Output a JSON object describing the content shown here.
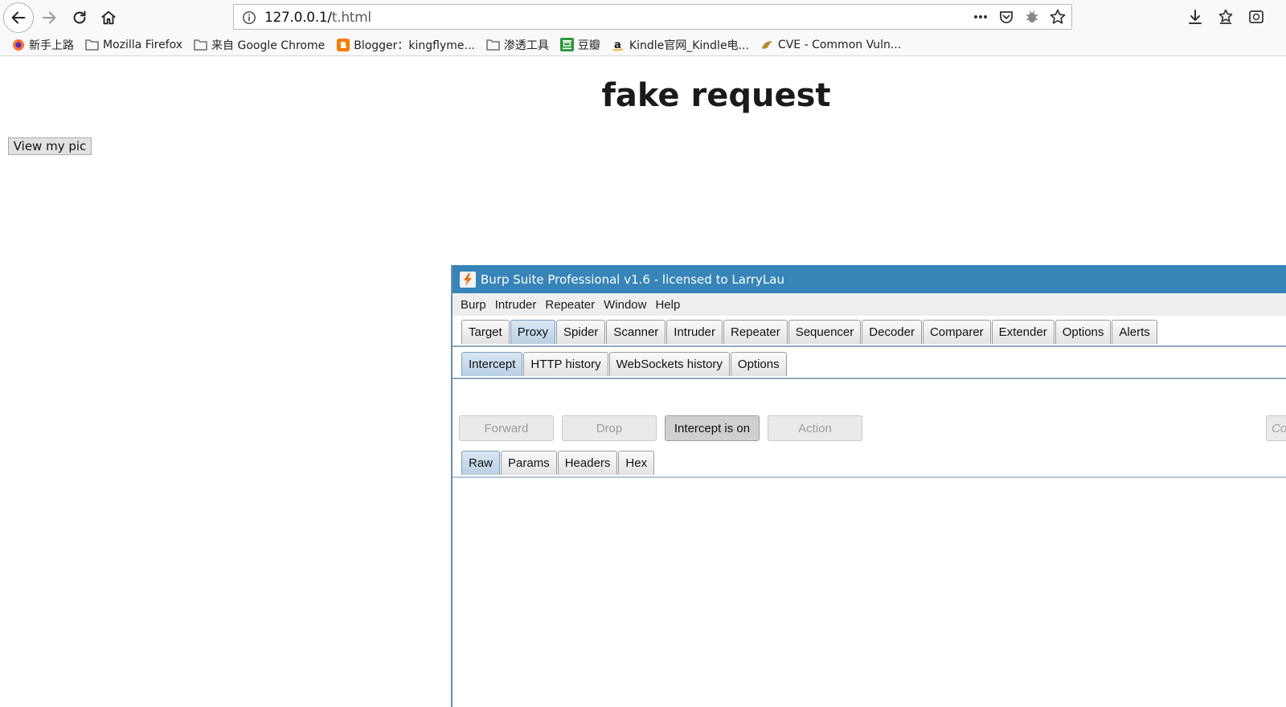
{
  "browser": {
    "url_prefix": "127.0.0.1/",
    "url_path": "t.html",
    "bookmarks": [
      {
        "icon": "firefox-icon",
        "label": "新手上路"
      },
      {
        "icon": "folder-icon",
        "label": "Mozilla Firefox"
      },
      {
        "icon": "folder-icon",
        "label": "来自 Google Chrome"
      },
      {
        "icon": "blogger-icon",
        "label": "Blogger：kingflyme..."
      },
      {
        "icon": "folder-icon",
        "label": "渗透工具"
      },
      {
        "icon": "douban-icon",
        "label": "豆瓣"
      },
      {
        "icon": "amazon-icon",
        "label": "Kindle官网_Kindle电..."
      },
      {
        "icon": "cve-icon",
        "label": "CVE - Common Vuln..."
      }
    ]
  },
  "page": {
    "title": "fake request",
    "button_label": "View my pic"
  },
  "burp": {
    "window_title": "Burp Suite Professional v1.6 - licensed to LarryLau",
    "menu": [
      "Burp",
      "Intruder",
      "Repeater",
      "Window",
      "Help"
    ],
    "main_tabs": [
      "Target",
      "Proxy",
      "Spider",
      "Scanner",
      "Intruder",
      "Repeater",
      "Sequencer",
      "Decoder",
      "Comparer",
      "Extender",
      "Options",
      "Alerts"
    ],
    "active_main_tab": "Proxy",
    "sub_tabs": [
      "Intercept",
      "HTTP history",
      "WebSockets history",
      "Options"
    ],
    "active_sub_tab": "Intercept",
    "actions": {
      "forward": "Forward",
      "drop": "Drop",
      "intercept": "Intercept is on",
      "action": "Action",
      "comment_placeholder": "Com"
    },
    "message_tabs": [
      "Raw",
      "Params",
      "Headers",
      "Hex"
    ],
    "active_message_tab": "Raw"
  },
  "colors": {
    "burp_titlebar": "#3684b8",
    "active_tab": "#b8cfe3"
  }
}
